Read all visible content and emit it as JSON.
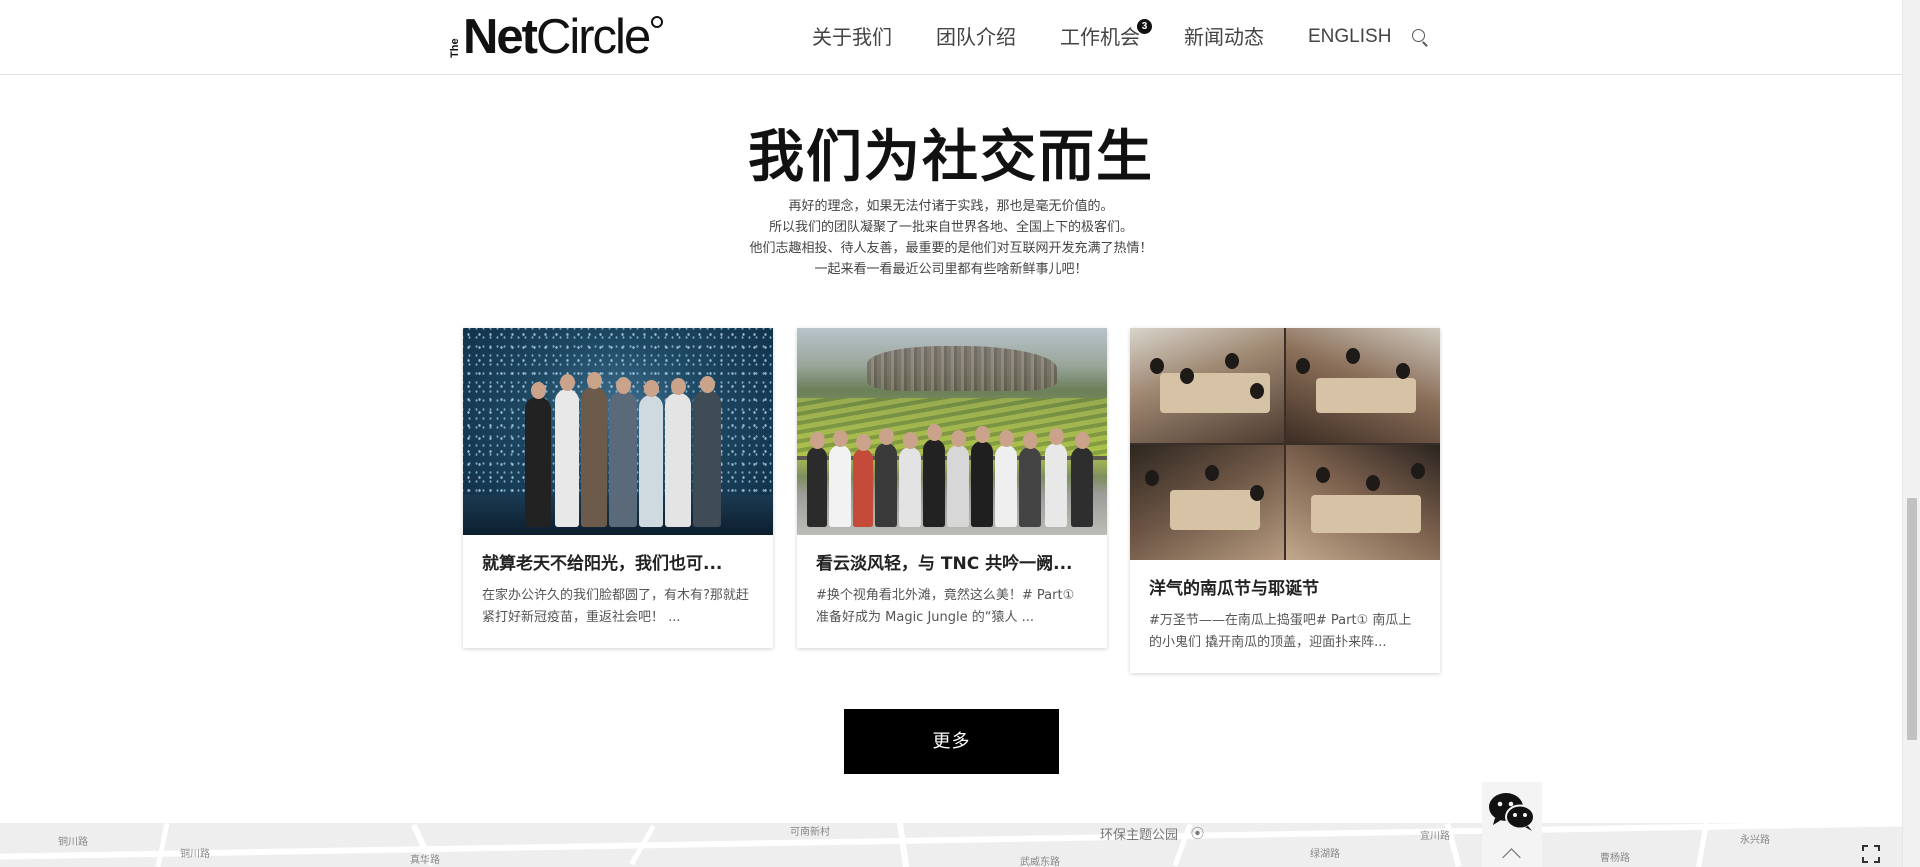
{
  "header": {
    "logo": {
      "the": "The",
      "net": "Net",
      "circle": "Circle"
    },
    "nav": [
      {
        "label": "关于我们"
      },
      {
        "label": "团队介绍"
      },
      {
        "label": "工作机会",
        "badge": "3"
      },
      {
        "label": "新闻动态"
      },
      {
        "label": "ENGLISH"
      }
    ],
    "search_icon": "search-icon"
  },
  "section": {
    "title": "我们为社交而生",
    "intro": [
      "再好的理念，如果无法付诸于实践，那也是毫无价值的。",
      "所以我们的团队凝聚了一批来自世界各地、全国上下的极客们。",
      "他们志趣相投、待人友善，最重要的是他们对互联网开发充满了热情！",
      "一起来看一看最近公司里都有些啥新鲜事儿吧！"
    ]
  },
  "cards": [
    {
      "title": "就算老天不给阳光，我们也可...",
      "excerpt": "  在家办公许久的我们脸都圆了，有木有?那就赶紧打好新冠疫苗，重返社会吧！ ...",
      "image": "team-photo-digital-art-room"
    },
    {
      "title": "看云淡风轻，与 TNC 共吟一阙...",
      "excerpt": "  #换个视角看北外滩，竟然这么美！# Part① 准备好成为 Magic Jungle 的“猿人 ...",
      "image": "team-photo-rice-terraces"
    },
    {
      "title": "洋气的南瓜节与耶诞节",
      "excerpt": "#万圣节——在南瓜上捣蛋吧# Part① 南瓜上的小鬼们 撬开南瓜的顶盖，迎面扑来阵...",
      "image": "team-dinner-collage"
    }
  ],
  "more_button": {
    "label": "更多"
  },
  "map": {
    "labels": [
      "铜川路",
      "铜川路",
      "真华路",
      "可南新村",
      "环保主题公园",
      "绿湖路",
      "永兴路",
      "武威东路",
      "曹杨路",
      "宜川路"
    ],
    "poi_icon": "map-pin-icon"
  },
  "floating": {
    "wechat_icon": "wechat-icon",
    "back_to_top_icon": "chevron-up-icon",
    "fullscreen_icon": "fullscreen-icon"
  },
  "colors": {
    "accent": "#000000",
    "text": "#333333",
    "nav_text": "#444444"
  }
}
